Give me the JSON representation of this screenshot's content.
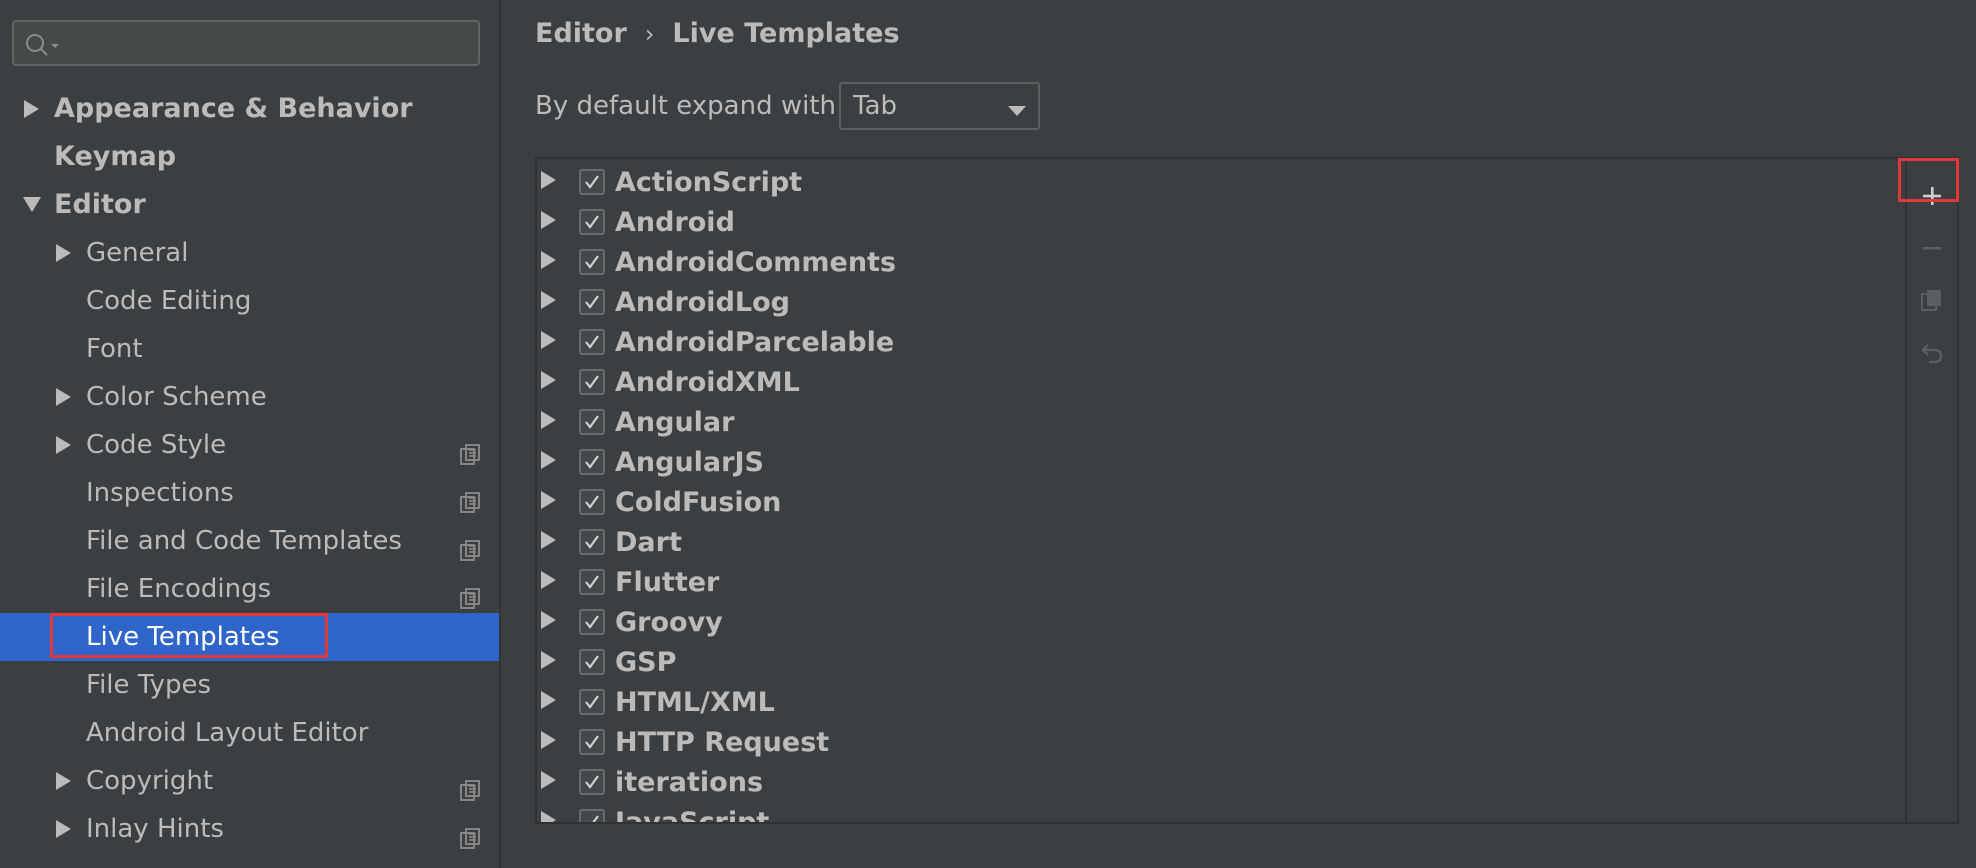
{
  "search": {
    "value": "",
    "icon": "search-icon"
  },
  "sidebar": {
    "items": [
      {
        "label": "Appearance & Behavior",
        "bold": true,
        "level": 0,
        "expandable": true,
        "expanded": false
      },
      {
        "label": "Keymap",
        "bold": true,
        "level": 0,
        "expandable": false
      },
      {
        "label": "Editor",
        "bold": true,
        "level": 0,
        "expandable": true,
        "expanded": true
      },
      {
        "label": "General",
        "level": 1,
        "expandable": true
      },
      {
        "label": "Code Editing",
        "level": 1
      },
      {
        "label": "Font",
        "level": 1
      },
      {
        "label": "Color Scheme",
        "level": 1,
        "expandable": true
      },
      {
        "label": "Code Style",
        "level": 1,
        "expandable": true,
        "copy_icon": true
      },
      {
        "label": "Inspections",
        "level": 1,
        "copy_icon": true
      },
      {
        "label": "File and Code Templates",
        "level": 1,
        "copy_icon": true
      },
      {
        "label": "File Encodings",
        "level": 1,
        "copy_icon": true
      },
      {
        "label": "Live Templates",
        "level": 1,
        "selected": true
      },
      {
        "label": "File Types",
        "level": 1
      },
      {
        "label": "Android Layout Editor",
        "level": 1
      },
      {
        "label": "Copyright",
        "level": 1,
        "expandable": true,
        "copy_icon": true
      },
      {
        "label": "Inlay Hints",
        "level": 1,
        "expandable": true,
        "copy_icon": true
      }
    ]
  },
  "breadcrumb": {
    "parent": "Editor",
    "separator": "›",
    "current": "Live Templates"
  },
  "expand": {
    "label": "By default expand with",
    "value": "Tab"
  },
  "templates": {
    "groups": [
      {
        "name": "ActionScript",
        "checked": true
      },
      {
        "name": "Android",
        "checked": true
      },
      {
        "name": "AndroidComments",
        "checked": true
      },
      {
        "name": "AndroidLog",
        "checked": true
      },
      {
        "name": "AndroidParcelable",
        "checked": true
      },
      {
        "name": "AndroidXML",
        "checked": true
      },
      {
        "name": "Angular",
        "checked": true
      },
      {
        "name": "AngularJS",
        "checked": true
      },
      {
        "name": "ColdFusion",
        "checked": true
      },
      {
        "name": "Dart",
        "checked": true
      },
      {
        "name": "Flutter",
        "checked": true
      },
      {
        "name": "Groovy",
        "checked": true
      },
      {
        "name": "GSP",
        "checked": true
      },
      {
        "name": "HTML/XML",
        "checked": true
      },
      {
        "name": "HTTP Request",
        "checked": true
      },
      {
        "name": "iterations",
        "checked": true
      },
      {
        "name": "JavaScript",
        "checked": true
      }
    ]
  },
  "toolbar": {
    "buttons": [
      {
        "name": "add-icon",
        "enabled": true
      },
      {
        "name": "remove-icon",
        "enabled": false
      },
      {
        "name": "copy-icon",
        "enabled": false
      },
      {
        "name": "restore-icon",
        "enabled": false
      }
    ]
  },
  "colors": {
    "background": "#3c3f41",
    "selection": "#2f65ca",
    "highlight": "#e0393a",
    "text": "#bbbbbb"
  }
}
